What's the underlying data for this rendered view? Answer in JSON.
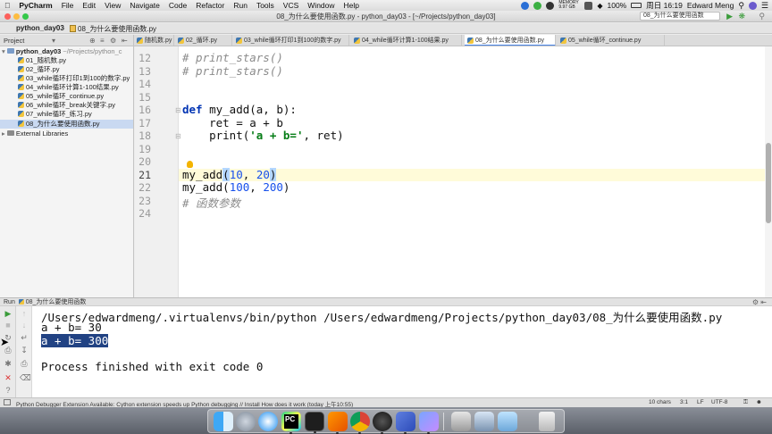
{
  "menubar": {
    "app": "PyCharm",
    "items": [
      "File",
      "Edit",
      "View",
      "Navigate",
      "Code",
      "Refactor",
      "Run",
      "Tools",
      "VCS",
      "Window",
      "Help"
    ],
    "memory": "MEMORY 9.97 GB",
    "battery": "100%",
    "clock": "周日 16:19",
    "user": "Edward Meng"
  },
  "window": {
    "title": "08_为什么要使用函数.py - python_day03 - [~/Projects/python_day03]",
    "run_config": "08_为什么要使用函数"
  },
  "navbar": {
    "project": "python_day03",
    "file": "08_为什么要使用函数.py"
  },
  "project_panel": {
    "label": "Project",
    "root": "python_day03",
    "root_path": "~/Projects/python_c",
    "files": [
      "01_随机数.py",
      "02_循环.py",
      "03_while循环打印1到100的数字.py",
      "04_while循环计算1-100结果.py",
      "05_while循环_continue.py",
      "06_while循环_break关键字.py",
      "07_while循环_练习.py",
      "08_为什么要使用函数.py"
    ],
    "external": "External Libraries"
  },
  "tabs": [
    "随机数.py",
    "02_循环.py",
    "03_while循环打印1到100的数字.py",
    "04_while循环计算1-100结果.py",
    "08_为什么要使用函数.py",
    "05_while循环_continue.py"
  ],
  "editor": {
    "line_numbers": [
      "12",
      "13",
      "14",
      "15",
      "16",
      "17",
      "18",
      "19",
      "20",
      "21",
      "22",
      "23",
      "24"
    ],
    "lines": {
      "l12": "# print_stars()",
      "l13": "# print_stars()",
      "l16_kw": "def",
      "l16_rest": " my_add(a, b):",
      "l17": "    ret = a + b",
      "l18_pre": "    print(",
      "l18_str": "'a + b='",
      "l18_post": ", ret)",
      "l21_a": "my_add",
      "l21_b": "(",
      "l21_c": "10",
      "l21_d": ", ",
      "l21_e": "20",
      "l21_f": ")",
      "l22_a": "my_add(",
      "l22_b": "100",
      "l22_c": ", ",
      "l22_d": "200",
      "l22_e": ")",
      "l23": "# 函数参数"
    }
  },
  "run": {
    "header": "Run",
    "config": "08_为什么要使用函数",
    "output": [
      "/Users/edwardmeng/.virtualenvs/bin/python /Users/edwardmeng/Projects/python_day03/08_为什么要使用函数.py",
      "a + b= 30",
      "a + b= 300",
      "Process finished with exit code 0"
    ]
  },
  "status": {
    "message": "Python Debugger Extension Available: Cython extension speeds up Python debugging // Install How does it work (today 上午10:55)",
    "chars": "10 chars",
    "position": "3:1",
    "line_sep": "LF",
    "encoding": "UTF-8"
  },
  "colors": {
    "keyword": "#0033b3",
    "string": "#067d17",
    "number": "#1750eb",
    "comment": "#8c8c8c",
    "selection": "#214283",
    "current_line": "#fffbd9"
  },
  "dock": {
    "apps": [
      "finder-icon",
      "launchpad-icon",
      "safari-icon",
      "pycharm-icon",
      "terminal-icon",
      "sublime-icon",
      "chrome-icon",
      "obs-icon",
      "mweb-icon",
      "papers-icon",
      "display-icon",
      "screen-icon",
      "trash-icon"
    ]
  }
}
